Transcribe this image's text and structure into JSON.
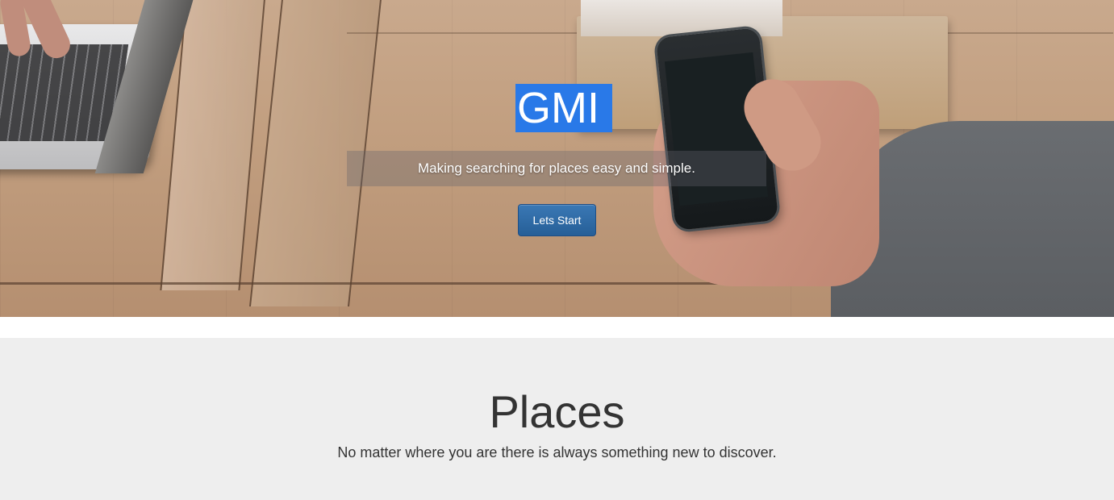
{
  "hero": {
    "title": "GMI",
    "subtitle": "Making searching for places easy and simple.",
    "cta_label": "Lets Start",
    "title_highlight_color": "#2979e8",
    "cta_color": "#2f6ca8"
  },
  "places": {
    "title": "Places",
    "subtitle": "No matter where you are there is always something new to discover.",
    "background_color": "#eeeeee"
  }
}
